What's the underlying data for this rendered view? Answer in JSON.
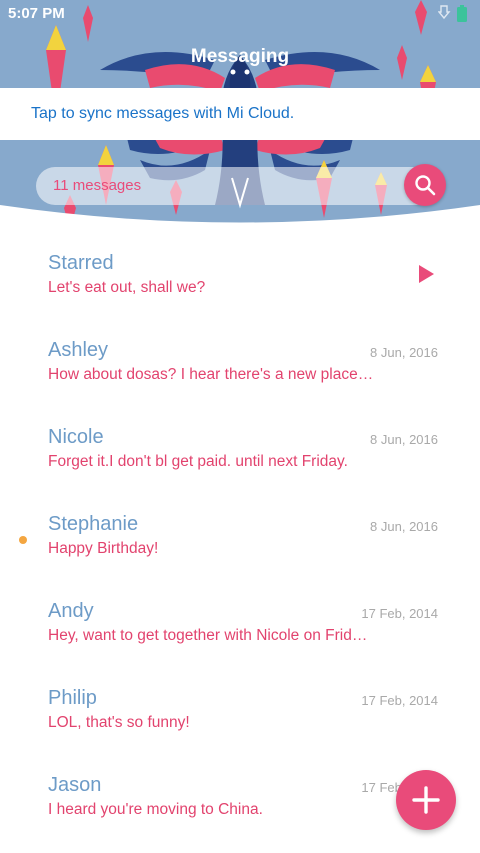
{
  "status_bar": {
    "time": "5:07 PM"
  },
  "header": {
    "title": "Messaging"
  },
  "sync_banner": {
    "text": "Tap to sync messages with Mi Cloud."
  },
  "search": {
    "text": "11 messages",
    "icon": "search-icon"
  },
  "colors": {
    "accent": "#e94b7a",
    "name": "#6d9bc7",
    "header_bg": "#87a9cc",
    "unread": "#f4a640",
    "link": "#1a73c8"
  },
  "conversations": [
    {
      "name": "Starred",
      "preview": "Let's eat out, shall we?",
      "date": "",
      "icon": "play-icon"
    },
    {
      "name": "Ashley",
      "preview": "How about dosas? I hear there's a new place…",
      "date": "8 Jun, 2016"
    },
    {
      "name": "Nicole",
      "preview": "Forget it.I don't bl get paid. until next Friday.",
      "date": "8 Jun, 2016"
    },
    {
      "name": "Stephanie",
      "preview": "Happy Birthday!",
      "date": "8 Jun, 2016",
      "unread": true
    },
    {
      "name": "Andy",
      "preview": "Hey, want to get together with Nicole on Frid…",
      "date": "17 Feb, 2014"
    },
    {
      "name": "Philip",
      "preview": "LOL, that's so funny!",
      "date": "17 Feb, 2014"
    },
    {
      "name": "Jason",
      "preview": "I heard you're moving to China.",
      "date": "17 Feb, 2014"
    }
  ],
  "fab": {
    "icon": "plus-icon"
  }
}
